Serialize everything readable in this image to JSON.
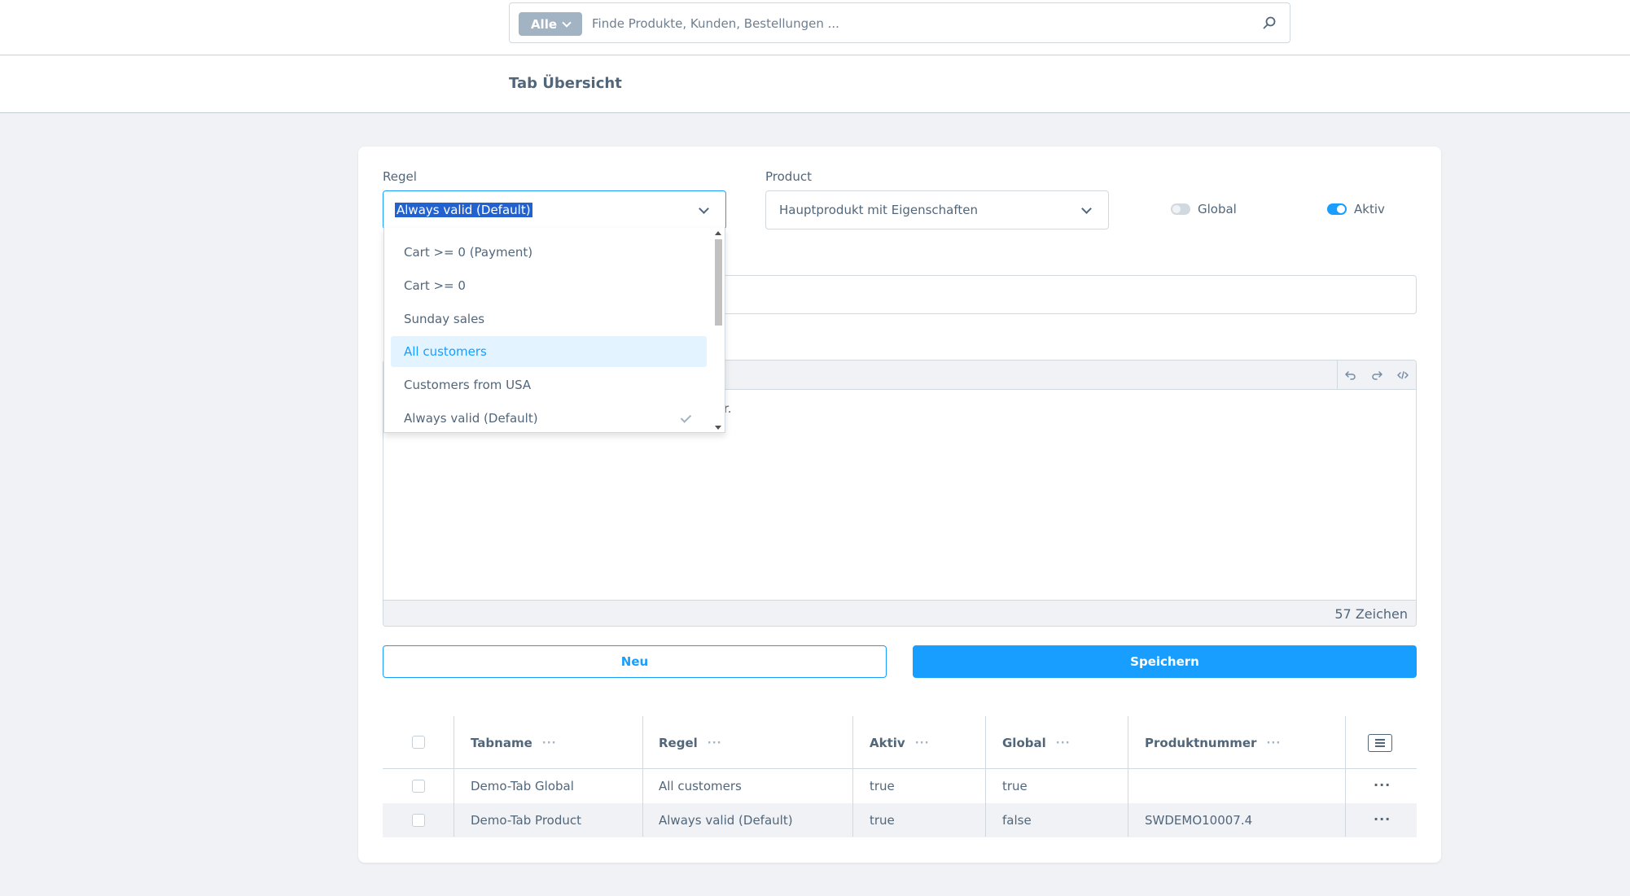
{
  "search": {
    "type_label": "Alle",
    "placeholder": "Finde Produkte, Kunden, Bestellungen ..."
  },
  "page": {
    "title": "Tab Übersicht"
  },
  "form": {
    "rule_label": "Regel",
    "rule_value": "Always valid (Default)",
    "product_label": "Product",
    "product_value": "Hauptprodukt mit Eigenschaften",
    "global_label": "Global",
    "global_on": false,
    "active_label": "Aktiv",
    "active_on": true
  },
  "dropdown": {
    "options": [
      "Cart >= 0 (Payment)",
      "Cart >= 0",
      "Sunday sales",
      "All customers",
      "Customers from USA",
      "Always valid (Default)"
    ],
    "highlighted": "All customers",
    "selected": "Always valid (Default)"
  },
  "editor": {
    "visible_text": "r.",
    "char_count": "57 Zeichen"
  },
  "buttons": {
    "new_label": "Neu",
    "save_label": "Speichern"
  },
  "grid": {
    "columns": [
      "Tabname",
      "Regel",
      "Aktiv",
      "Global",
      "Produktnummer"
    ],
    "column_menu": "···",
    "row_action": "···",
    "rows": [
      [
        "Demo-Tab Global",
        "All customers",
        "true",
        "true",
        ""
      ],
      [
        "Demo-Tab Product",
        "Always valid (Default)",
        "true",
        "false",
        "SWDEMO10007.4"
      ]
    ]
  },
  "colors": {
    "accent": "#189eff",
    "text": "#52667a",
    "border": "#d1d9e0",
    "background": "#f0f2f5",
    "highlight": "#e3f3ff",
    "selection": "#2261d0"
  }
}
